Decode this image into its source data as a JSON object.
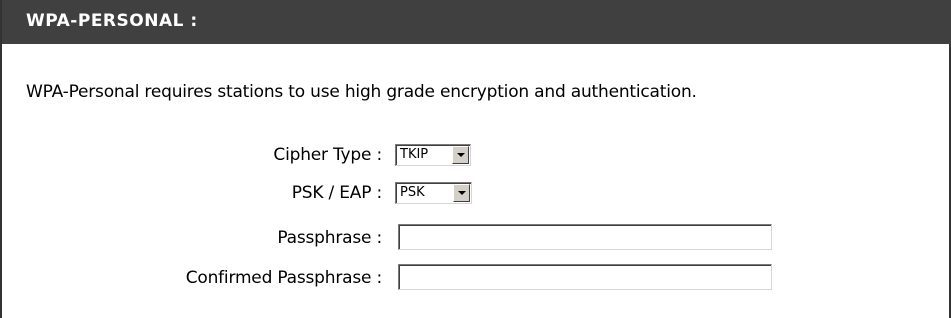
{
  "section": {
    "title": "WPA-PERSONAL :",
    "description": "WPA-Personal requires stations to use high grade encryption and authentication."
  },
  "fields": {
    "cipher_type": {
      "label": "Cipher Type :",
      "value": "TKIP"
    },
    "psk_eap": {
      "label": "PSK / EAP :",
      "value": "PSK"
    },
    "passphrase": {
      "label": "Passphrase :",
      "value": ""
    },
    "confirmed_passphrase": {
      "label": "Confirmed Passphrase :",
      "value": ""
    }
  },
  "colors": {
    "header_background": "#404040",
    "header_text": "#ffffff",
    "body_background": "#ffffff"
  },
  "icons": {
    "dropdown": "chevron-down-icon"
  }
}
